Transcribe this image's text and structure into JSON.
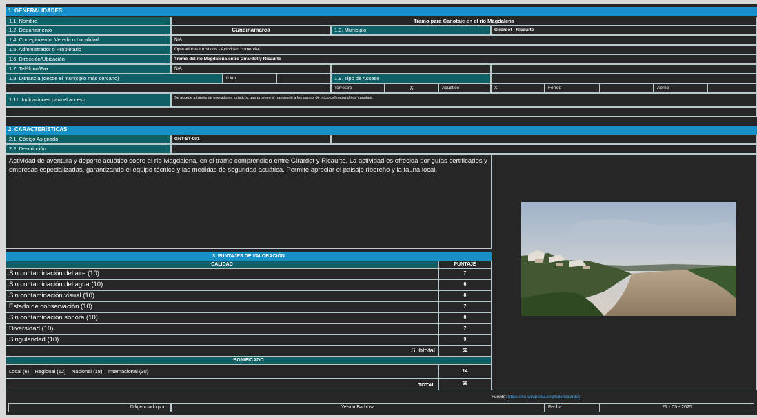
{
  "colors": {
    "accent_blue": "#1790c8",
    "header_teal": "#0f5f66",
    "background": "#262626"
  },
  "section1": {
    "title": "1. GENERALIDADES",
    "nombre_label": "1.1. Nombre",
    "nombre_value": "Tramo para Canotaje en el río Magdalena",
    "departamento_label": "1.2. Departamento",
    "departamento_value": "Cundinamarca",
    "municipio_label": "1.3. Municipio",
    "municipio_value": "Girardot - Ricaurte",
    "corregimiento_label": "1.4. Corregimiento, Vereda o Localidad",
    "corregimiento_value": "N/A",
    "administrador_label": "1.5. Administrador o Propietario",
    "administrador_value": "Operadores turísticos - Actividad comercial",
    "direccion_label": "1.6. Dirección/Ubicación",
    "direccion_value": "Tramo del río Magdalena entre Girardot y Ricaurte",
    "telefono_label": "1.7. Teléfono/Fax",
    "telefono_value": "N/A",
    "distancia_label": "1.8. Distancia (desde el municipio más cercano)",
    "distancia_value": "0 km",
    "tipo_acceso_label": "1.9. Tipo de Acceso",
    "acceso": {
      "terrestre": "Terrestre",
      "mark": "X",
      "acuatico": "Acuático",
      "acuatico_mark": "X",
      "ferreo": "Férreo",
      "aereo": "Aéreo"
    },
    "indicaciones_label": "1.11. Indicaciones para el acceso",
    "indicaciones_value": "Se accede a través de operadores turísticos que proveen el transporte a los puntos de inicio del recorrido de canotaje."
  },
  "section2": {
    "title": "2. CARACTERÍSTICAS",
    "codigo_label": "2.1. Código Asignado",
    "codigo_value": "GNT-ST-001",
    "descripcion_label": "2.2. Descripción",
    "descripcion_text": "Actividad de aventura y deporte acuático sobre el río Magdalena, en el tramo comprendido entre Girardot y Ricaurte. La actividad es ofrecida por guías certificados y empresas especializadas, garantizando el equipo técnico y las medidas de seguridad acuática. Permite apreciar el paisaje ribereño y la fauna local."
  },
  "section3": {
    "title": "3. PUNTAJES DE VALORACIÓN",
    "calidad_header": "CALIDAD",
    "puntaje_header": "PUNTAJE",
    "rows": [
      {
        "label": "Sin contaminación del aire (10)",
        "value": "7"
      },
      {
        "label": "Sin contaminación del agua (10)",
        "value": "6"
      },
      {
        "label": "Sin contaminación visual (10)",
        "value": "8"
      },
      {
        "label": "Estado de conservación (10)",
        "value": "7"
      },
      {
        "label": "Sin contaminación sonora (10)",
        "value": "8"
      },
      {
        "label": "Diversidad (10)",
        "value": "7"
      },
      {
        "label": "Singularidad (10)",
        "value": "9"
      }
    ],
    "subtotal_label": "Subtotal",
    "subtotal_value": "52",
    "bonificado_header": "BONIFICADO",
    "bonificado_options": "Local (6)    Regional (12)    Nacional (18)    Internacional (30)",
    "bonificado_value": "14",
    "total_label": "TOTAL",
    "total_value": "66"
  },
  "footer": {
    "fuente_label": "Fuente:",
    "fuente_link": "https://es.wikipedia.org/wiki/Girardot",
    "diligenciado_label": "Diligenciado por:",
    "diligenciado_value": "Yeison Barbosa",
    "fecha_label": "Fecha:",
    "fecha_value": "21 - 05 - 2025"
  }
}
